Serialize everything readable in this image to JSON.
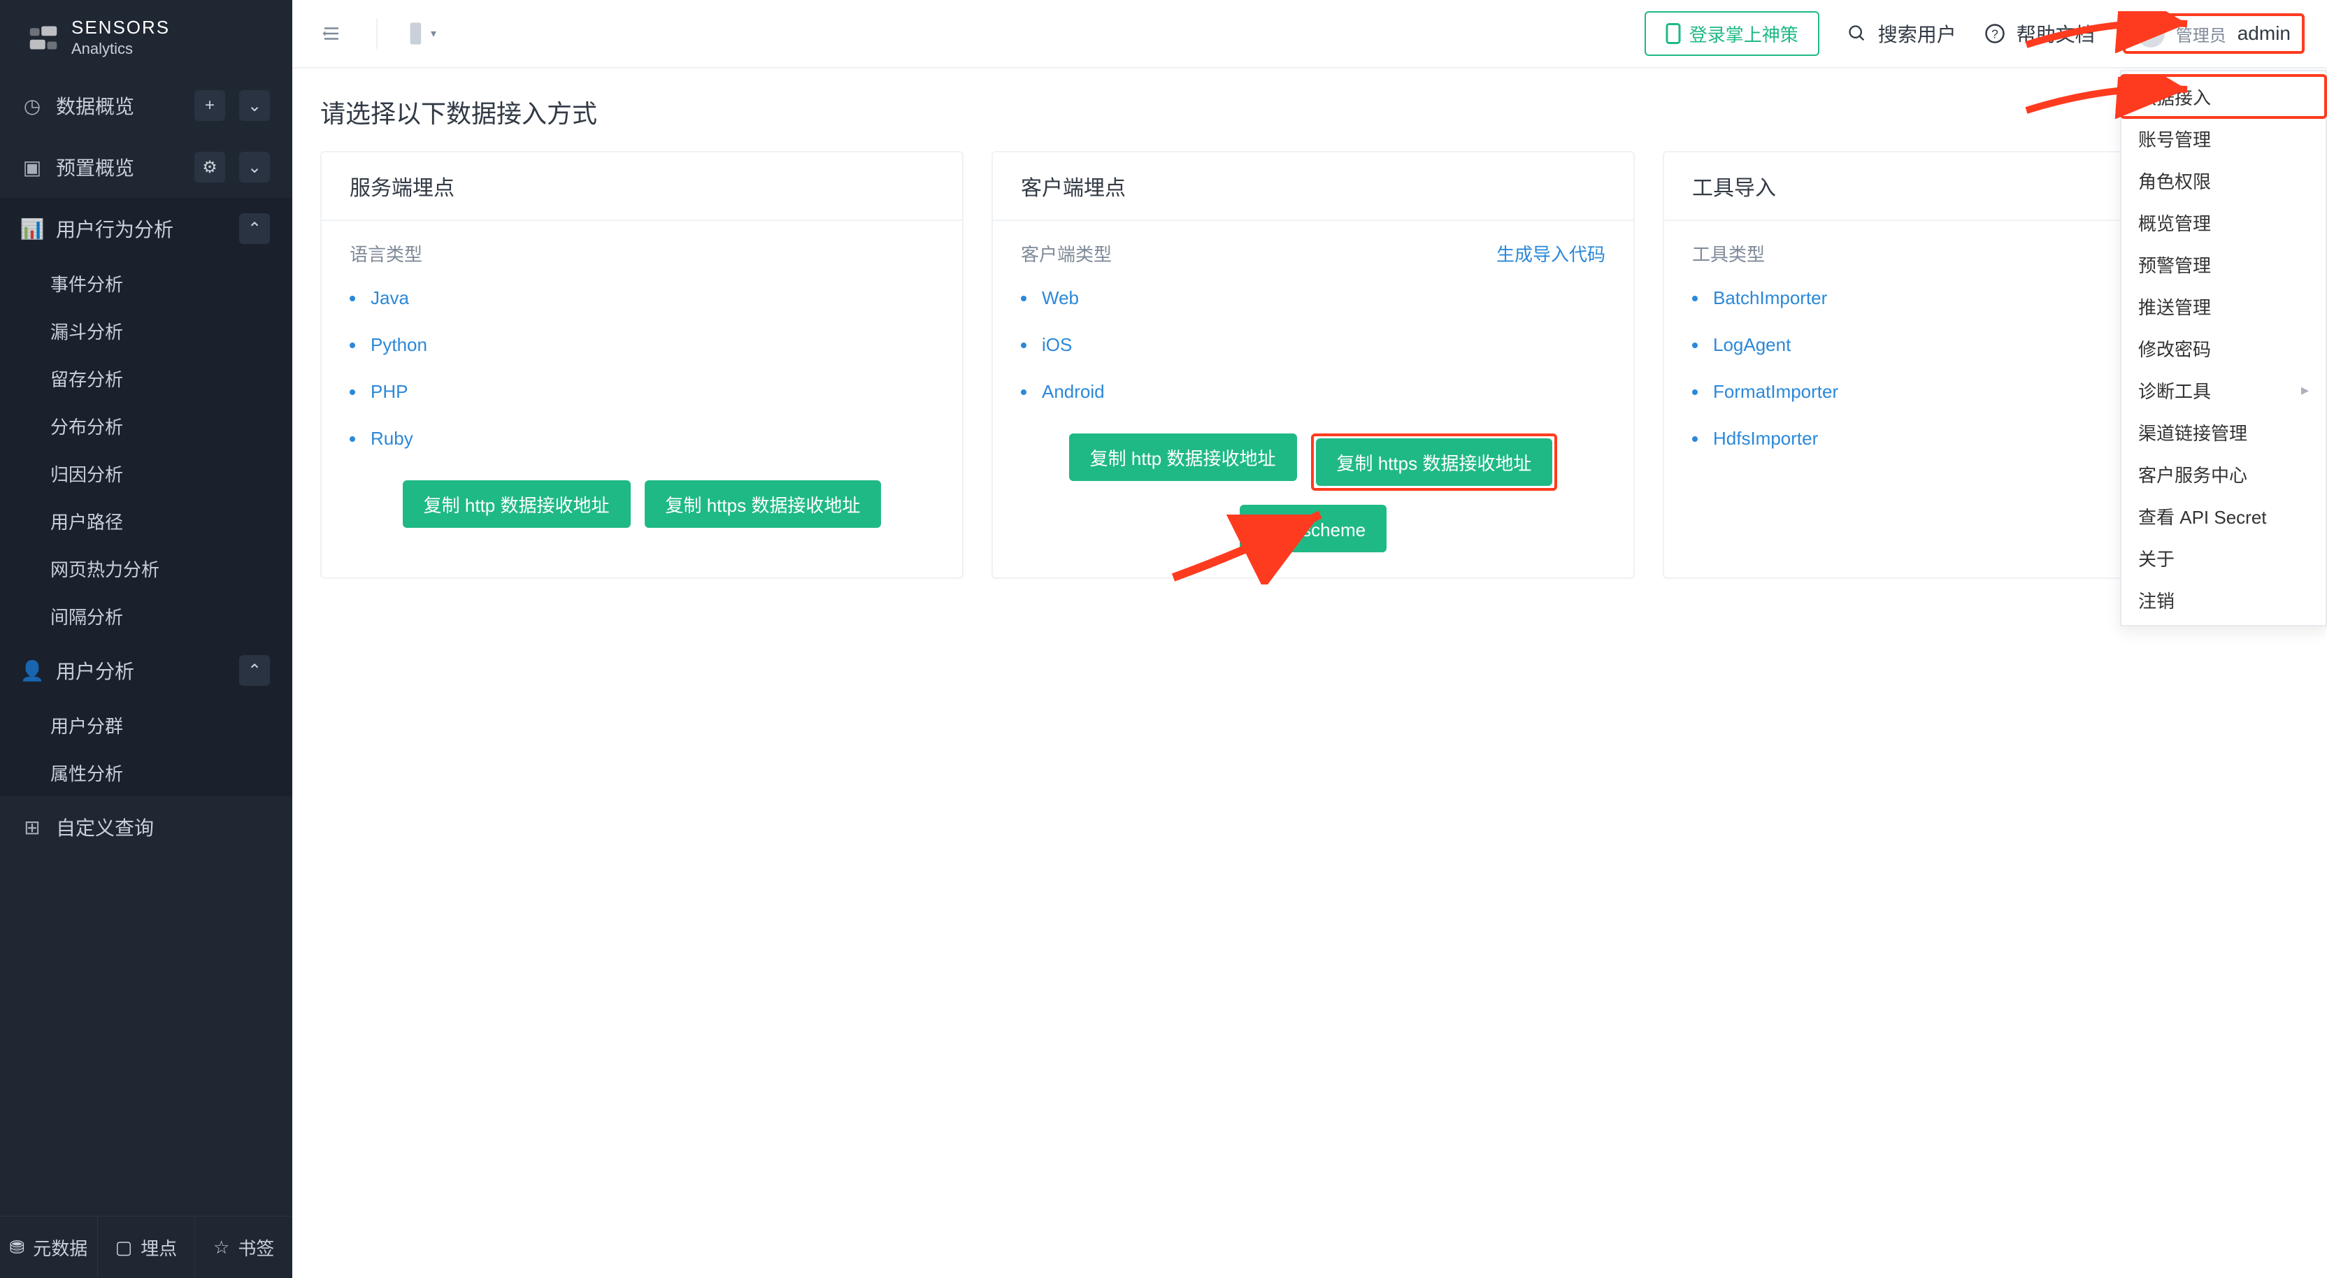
{
  "brand": {
    "name": "SENSORS",
    "tag": "Analytics"
  },
  "sidebar": {
    "overview": {
      "label": "数据概览"
    },
    "preset": {
      "label": "预置概览"
    },
    "behavior": {
      "label": "用户行为分析",
      "items": [
        "事件分析",
        "漏斗分析",
        "留存分析",
        "分布分析",
        "归因分析",
        "用户路径",
        "网页热力分析",
        "间隔分析"
      ]
    },
    "useranal": {
      "label": "用户分析",
      "items": [
        "用户分群",
        "属性分析"
      ]
    },
    "custom": {
      "label": "自定义查询"
    },
    "footer": {
      "meta": "元数据",
      "tracking": "埋点",
      "bookmark": "书签"
    }
  },
  "topbar": {
    "login": "登录掌上神策",
    "search": "搜索用户",
    "help": "帮助文档",
    "role": "管理员",
    "user": "admin"
  },
  "page": {
    "title": "请选择以下数据接入方式"
  },
  "cards": {
    "server": {
      "title": "服务端埋点",
      "subtitle": "语言类型",
      "items": [
        "Java",
        "Python",
        "PHP",
        "Ruby"
      ],
      "btns": [
        "复制 http 数据接收地址",
        "复制 https 数据接收地址"
      ]
    },
    "client": {
      "title": "客户端埋点",
      "subtitle": "客户端类型",
      "extraLink": "生成导入代码",
      "items": [
        "Web",
        "iOS",
        "Android"
      ],
      "btns": [
        "复制 http 数据接收地址",
        "复制 https 数据接收地址",
        "复制 scheme"
      ]
    },
    "tool": {
      "title": "工具导入",
      "subtitle": "工具类型",
      "items": [
        "BatchImporter",
        "LogAgent",
        "FormatImporter",
        "HdfsImporter"
      ]
    }
  },
  "menu": {
    "items": [
      "数据接入",
      "账号管理",
      "角色权限",
      "概览管理",
      "预警管理",
      "推送管理",
      "修改密码",
      "诊断工具",
      "渠道链接管理",
      "客户服务中心",
      "查看 API Secret",
      "关于",
      "注销"
    ],
    "hasSubmenu": {
      "诊断工具": true
    }
  }
}
